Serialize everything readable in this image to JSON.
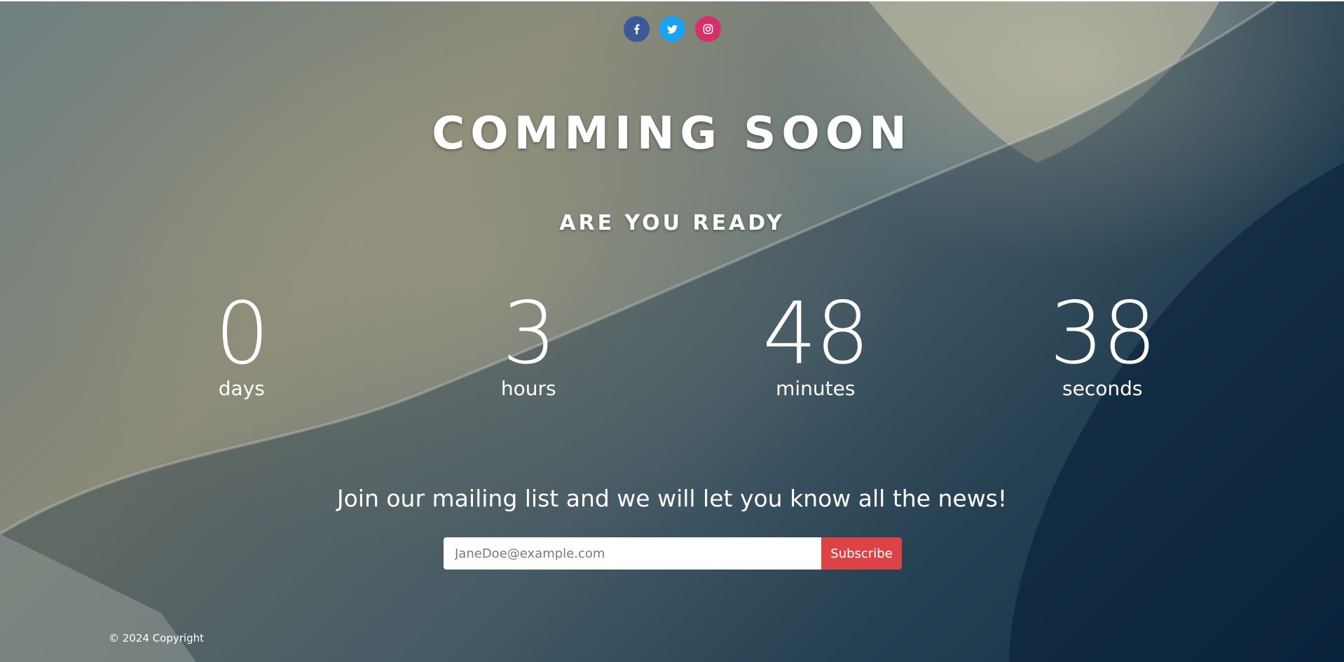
{
  "social": {
    "facebook": {
      "icon": "facebook-icon",
      "color": "#3b5998"
    },
    "twitter": {
      "icon": "twitter-icon",
      "color": "#1da1f2"
    },
    "instagram": {
      "icon": "instagram-icon",
      "color": "#d6306b"
    }
  },
  "hero": {
    "title": "COMMING SOON",
    "subtitle": "ARE YOU READY"
  },
  "countdown": {
    "days": {
      "value": "0",
      "label": "days"
    },
    "hours": {
      "value": "3",
      "label": "hours"
    },
    "minutes": {
      "value": "48",
      "label": "minutes"
    },
    "seconds": {
      "value": "38",
      "label": "seconds"
    }
  },
  "mailing": {
    "heading": "Join our mailing list and we will let you know all the news!",
    "email_placeholder": "JaneDoe@example.com",
    "subscribe_label": "Subscribe",
    "subscribe_color": "#dc4346"
  },
  "footer": {
    "copyright": "© 2024 Copyright"
  }
}
